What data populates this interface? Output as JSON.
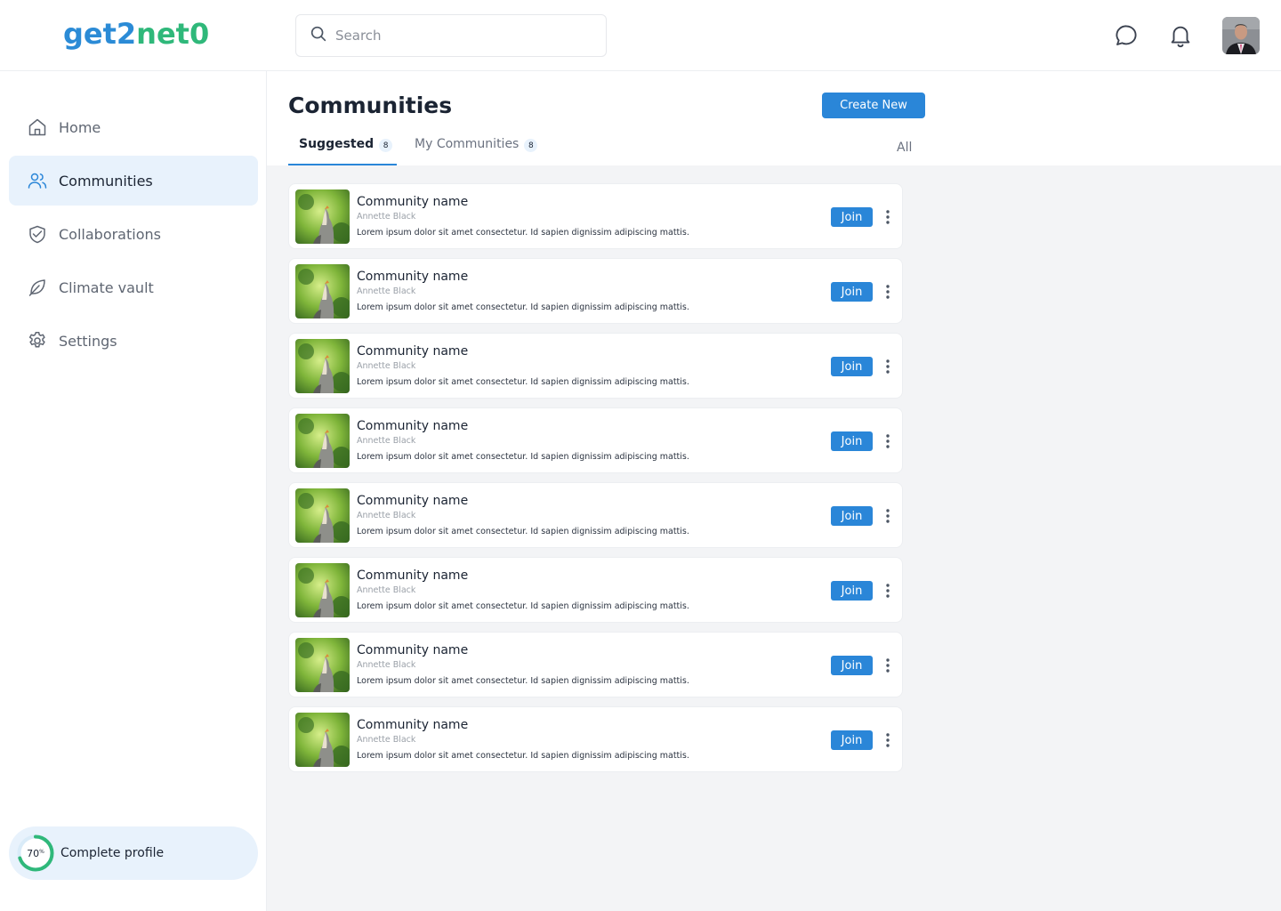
{
  "brand": {
    "logo_part1": "get2",
    "logo_part2": "net0",
    "primary": "#2a86d8",
    "green": "#2fb87a"
  },
  "search": {
    "placeholder": "Search",
    "value": ""
  },
  "header_icons": [
    "chat-icon",
    "bell-icon"
  ],
  "sidebar": {
    "items": [
      {
        "label": "Home",
        "icon": "home-icon",
        "active": false
      },
      {
        "label": "Communities",
        "icon": "users-icon",
        "active": true
      },
      {
        "label": "Collaborations",
        "icon": "handshake-icon",
        "active": false
      },
      {
        "label": "Climate vault",
        "icon": "leaf-icon",
        "active": false
      },
      {
        "label": "Settings",
        "icon": "gear-icon",
        "active": false
      }
    ],
    "profile": {
      "percent_label": "70",
      "percent_sign": "%",
      "progress": 0.7,
      "label": "Complete profile"
    }
  },
  "main": {
    "title": "Communities",
    "create_label": "Create New",
    "tabs": [
      {
        "label": "Suggested",
        "count": "8",
        "active": true
      },
      {
        "label": "My Communities",
        "count": "8",
        "active": false
      }
    ],
    "all_label": "All",
    "communities": [
      {
        "name": "Community name",
        "owner": "Annette Black",
        "description": "Lorem ipsum dolor sit amet consectetur. Id sapien dignissim adipiscing mattis.",
        "join_label": "Join"
      },
      {
        "name": "Community name",
        "owner": "Annette Black",
        "description": "Lorem ipsum dolor sit amet consectetur. Id sapien dignissim adipiscing mattis.",
        "join_label": "Join"
      },
      {
        "name": "Community name",
        "owner": "Annette Black",
        "description": "Lorem ipsum dolor sit amet consectetur. Id sapien dignissim adipiscing mattis.",
        "join_label": "Join"
      },
      {
        "name": "Community name",
        "owner": "Annette Black",
        "description": "Lorem ipsum dolor sit amet consectetur. Id sapien dignissim adipiscing mattis.",
        "join_label": "Join"
      },
      {
        "name": "Community name",
        "owner": "Annette Black",
        "description": "Lorem ipsum dolor sit amet consectetur. Id sapien dignissim adipiscing mattis.",
        "join_label": "Join"
      },
      {
        "name": "Community name",
        "owner": "Annette Black",
        "description": "Lorem ipsum dolor sit amet consectetur. Id sapien dignissim adipiscing mattis.",
        "join_label": "Join"
      },
      {
        "name": "Community name",
        "owner": "Annette Black",
        "description": "Lorem ipsum dolor sit amet consectetur. Id sapien dignissim adipiscing mattis.",
        "join_label": "Join"
      },
      {
        "name": "Community name",
        "owner": "Annette Black",
        "description": "Lorem ipsum dolor sit amet consectetur. Id sapien dignissim adipiscing mattis.",
        "join_label": "Join"
      }
    ]
  }
}
